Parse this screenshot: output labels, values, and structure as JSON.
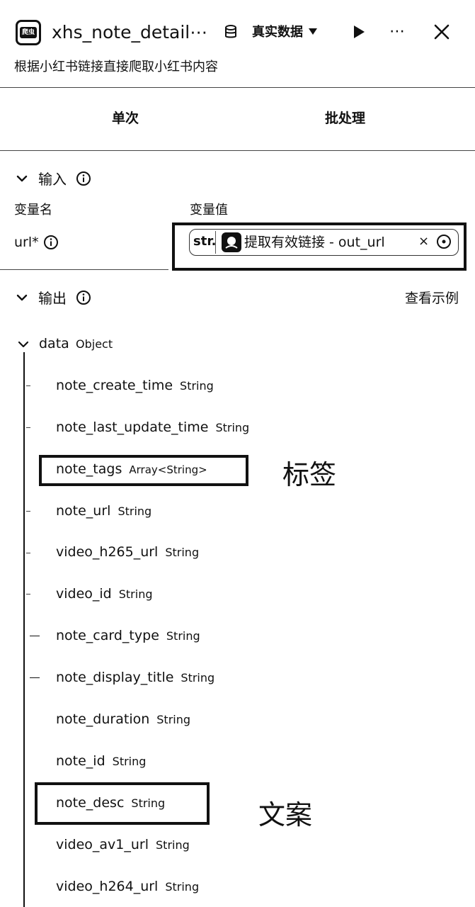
{
  "header": {
    "app_icon_text": "爬虫",
    "title": "xhs_note_detail⋯",
    "data_mode": "真实数据",
    "more_label": "⋯",
    "subtitle": "根据小红书链接直接爬取小红书内容"
  },
  "tabs": [
    {
      "label": "单次"
    },
    {
      "label": "批处理"
    }
  ],
  "input_section": {
    "label": "输入",
    "col_name": "变量名",
    "col_value": "变量值",
    "var_name": "url*",
    "value": {
      "type_tag": "str.",
      "reference": "提取有效链接 - out_url",
      "clear_label": "×"
    }
  },
  "output_section": {
    "label": "输出",
    "example_link": "查看示例",
    "root": {
      "name": "data",
      "type": "Object"
    },
    "fields": [
      {
        "name": "note_create_time",
        "type": "String"
      },
      {
        "name": "note_last_update_time",
        "type": "String"
      },
      {
        "name": "note_tags",
        "type": "Array<String>"
      },
      {
        "name": "note_url",
        "type": "String"
      },
      {
        "name": "video_h265_url",
        "type": "String"
      },
      {
        "name": "video_id",
        "type": "String"
      },
      {
        "name": "note_card_type",
        "type": "String"
      },
      {
        "name": "note_display_title",
        "type": "String"
      },
      {
        "name": "note_duration",
        "type": "String"
      },
      {
        "name": "note_id",
        "type": "String"
      },
      {
        "name": "note_desc",
        "type": "String"
      },
      {
        "name": "video_av1_url",
        "type": "String"
      },
      {
        "name": "video_h264_url",
        "type": "String"
      }
    ]
  },
  "annotations": {
    "tags_note": "标签",
    "desc_note": "文案"
  }
}
